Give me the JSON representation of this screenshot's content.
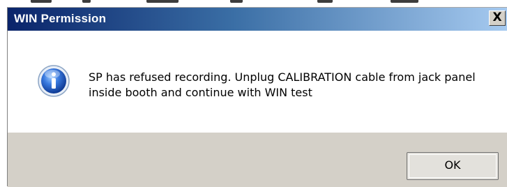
{
  "dialog": {
    "title": "WIN Permission",
    "close_glyph": "✕",
    "close_icon": "close-icon",
    "message_icon": "info-icon",
    "message": "SP has refused recording. Unplug CALIBRATION cable from jack panel inside booth and continue with WIN test",
    "ok_label": "OK"
  },
  "colors": {
    "title_start": "#0a246a",
    "title_end": "#a6caf0",
    "footer_bg": "#d4d0c8",
    "icon_blue": "#1f5fc8"
  }
}
